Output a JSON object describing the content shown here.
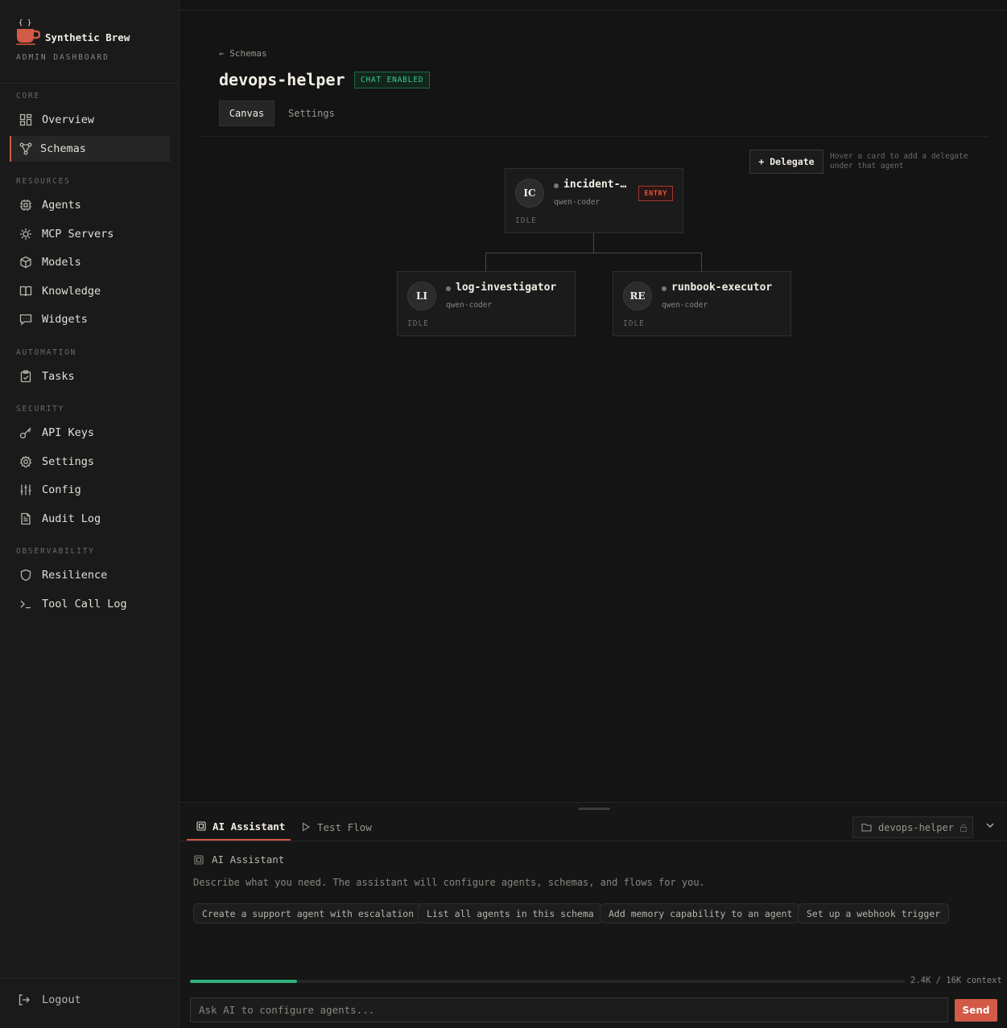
{
  "brand": {
    "name": "Synthetic Brew",
    "subtitle": "ADMIN DASHBOARD"
  },
  "sidebar": {
    "sections": [
      {
        "title": "CORE",
        "items": [
          {
            "label": "Overview",
            "icon": "grid-icon"
          },
          {
            "label": "Schemas",
            "icon": "schema-icon",
            "active": true
          }
        ]
      },
      {
        "title": "RESOURCES",
        "items": [
          {
            "label": "Agents",
            "icon": "cpu-icon"
          },
          {
            "label": "MCP Servers",
            "icon": "sun-icon"
          },
          {
            "label": "Models",
            "icon": "cube-icon"
          },
          {
            "label": "Knowledge",
            "icon": "book-icon"
          },
          {
            "label": "Widgets",
            "icon": "chat-icon"
          }
        ]
      },
      {
        "title": "AUTOMATION",
        "items": [
          {
            "label": "Tasks",
            "icon": "clipboard-icon"
          }
        ]
      },
      {
        "title": "SECURITY",
        "items": [
          {
            "label": "API Keys",
            "icon": "key-icon"
          },
          {
            "label": "Settings",
            "icon": "gear-icon"
          },
          {
            "label": "Config",
            "icon": "sliders-icon"
          },
          {
            "label": "Audit Log",
            "icon": "document-icon"
          }
        ]
      },
      {
        "title": "OBSERVABILITY",
        "items": [
          {
            "label": "Resilience",
            "icon": "shield-icon"
          },
          {
            "label": "Tool Call Log",
            "icon": "terminal-icon"
          }
        ]
      }
    ],
    "logout": "Logout"
  },
  "page": {
    "breadcrumb": "← Schemas",
    "title": "devops-helper",
    "badge": "CHAT ENABLED",
    "tabs": {
      "canvas": "Canvas",
      "settings": "Settings"
    }
  },
  "canvas": {
    "delegate_button": "+ Delegate",
    "delegate_hint": "Hover a card to add a delegate under that agent",
    "agents": {
      "entry": {
        "initials": "IC",
        "name": "incident-…",
        "model": "qwen-coder",
        "status": "IDLE",
        "tag": "ENTRY"
      },
      "left": {
        "initials": "LI",
        "name": "log-investigator",
        "model": "qwen-coder",
        "status": "IDLE"
      },
      "right": {
        "initials": "RE",
        "name": "runbook-executor",
        "model": "qwen-coder",
        "status": "IDLE"
      }
    }
  },
  "panel": {
    "tabs": {
      "assistant": "AI Assistant",
      "test_flow": "Test Flow"
    },
    "schema_select": "devops-helper",
    "assistant_title": "AI Assistant",
    "description": "Describe what you need. The assistant will configure agents, schemas, and flows for you.",
    "suggestions": [
      "Create a support agent with escalation",
      "List all agents in this schema",
      "Add memory capability to an agent",
      "Set up a webhook trigger"
    ],
    "context": {
      "label": "2.4K / 16K context",
      "fraction": 0.15
    },
    "input_placeholder": "Ask AI to configure agents...",
    "send": "Send"
  },
  "colors": {
    "accent": "#d25a46",
    "success": "#3fc98a",
    "progress": "#2fb37a"
  }
}
